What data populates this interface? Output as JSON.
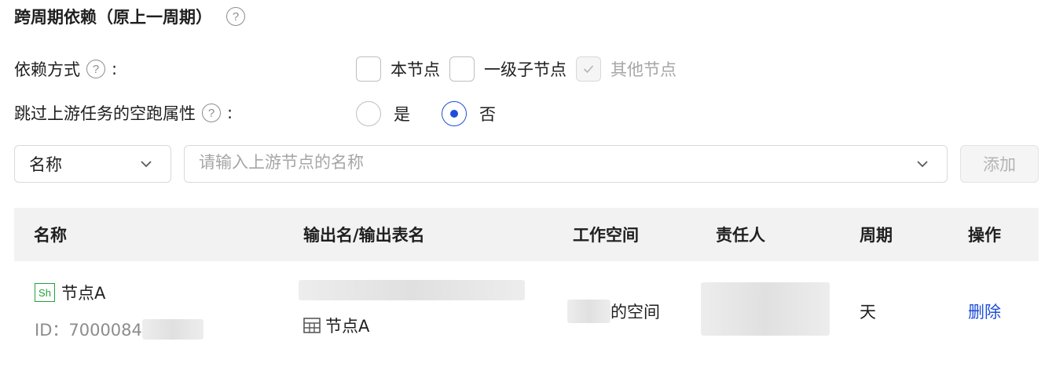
{
  "section": {
    "title": "跨周期依赖（原上一周期）",
    "help_icon": "question-circle-icon"
  },
  "dependency_mode": {
    "label": "依赖方式",
    "colon": ":",
    "options": [
      {
        "label": "本节点",
        "checked": false,
        "disabled": false
      },
      {
        "label": "一级子节点",
        "checked": false,
        "disabled": false
      },
      {
        "label": "其他节点",
        "checked": true,
        "disabled": true
      }
    ]
  },
  "skip_dry_run": {
    "label": "跳过上游任务的空跑属性",
    "colon": ":",
    "options": [
      {
        "label": "是",
        "selected": false
      },
      {
        "label": "否",
        "selected": true
      }
    ]
  },
  "filter": {
    "select_value": "名称",
    "search_placeholder": "请输入上游节点的名称",
    "add_label": "添加"
  },
  "table": {
    "columns": [
      "名称",
      "输出名/输出表名",
      "工作空间",
      "责任人",
      "周期",
      "操作"
    ],
    "rows": [
      {
        "type_badge": "Sh",
        "name": "节点A",
        "id_prefix": "ID：7000084",
        "output_table": "节点A",
        "workspace_suffix": "的空间",
        "period": "天",
        "action": "删除"
      }
    ]
  },
  "colors": {
    "accent": "#1d4ed8",
    "badge_green": "#22a33a",
    "header_bg": "#f2f2f2"
  }
}
